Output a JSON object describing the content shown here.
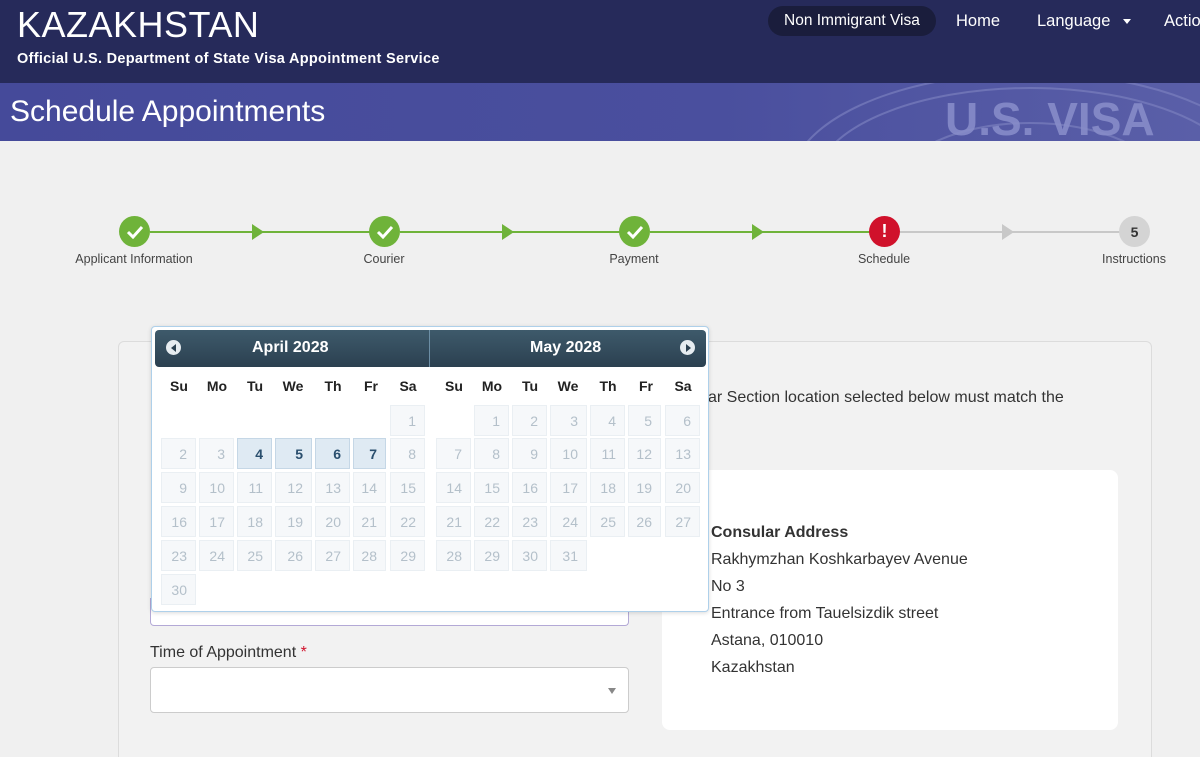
{
  "header": {
    "brand_title": "Kazakhstan",
    "brand_subtitle": "Official U.S. Department of State Visa Appointment Service",
    "visa_type_pill": "Non Immigrant Visa",
    "nav_home": "Home",
    "nav_language": "Language",
    "nav_actions": "Actio"
  },
  "banner": {
    "title": "Schedule Appointments",
    "seal_text": "U.S. VISA"
  },
  "stepper": {
    "steps": [
      {
        "label": "Applicant Information",
        "status": "done"
      },
      {
        "label": "Courier",
        "status": "done"
      },
      {
        "label": "Payment",
        "status": "done"
      },
      {
        "label": "Schedule",
        "status": "error"
      },
      {
        "label": "Instructions",
        "status": "pending",
        "number": "5"
      }
    ]
  },
  "form": {
    "intro_text_partial": "ar Section location selected below must match the",
    "time_label": "Time of Appointment",
    "required_mark": "*",
    "time_value": ""
  },
  "address": {
    "heading": "Consular Address",
    "lines": [
      "Rakhymzhan Koshkarbayev Avenue",
      "No 3",
      "Entrance from Tauelsizdik street",
      "Astana, 010010",
      "Kazakhstan"
    ]
  },
  "datepicker": {
    "weekdays": [
      "Su",
      "Mo",
      "Tu",
      "We",
      "Th",
      "Fr",
      "Sa"
    ],
    "months": [
      {
        "title": "April 2028",
        "days": [
          [
            "",
            "",
            "",
            "",
            "",
            "",
            "1"
          ],
          [
            "2",
            "3",
            "4",
            "5",
            "6",
            "7",
            "8"
          ],
          [
            "9",
            "10",
            "11",
            "12",
            "13",
            "14",
            "15"
          ],
          [
            "16",
            "17",
            "18",
            "19",
            "20",
            "21",
            "22"
          ],
          [
            "23",
            "24",
            "25",
            "26",
            "27",
            "28",
            "29"
          ],
          [
            "30",
            "",
            "",
            "",
            "",
            "",
            ""
          ]
        ],
        "available": [
          "4",
          "5",
          "6",
          "7"
        ]
      },
      {
        "title": "May 2028",
        "days": [
          [
            "",
            "1",
            "2",
            "3",
            "4",
            "5",
            "6"
          ],
          [
            "7",
            "8",
            "9",
            "10",
            "11",
            "12",
            "13"
          ],
          [
            "14",
            "15",
            "16",
            "17",
            "18",
            "19",
            "20"
          ],
          [
            "21",
            "22",
            "23",
            "24",
            "25",
            "26",
            "27"
          ],
          [
            "28",
            "29",
            "30",
            "31",
            "",
            "",
            ""
          ]
        ],
        "available": []
      }
    ]
  },
  "colors": {
    "header_bg": "#262a5a",
    "banner_bg": "#4a4f9e",
    "step_done": "#6fb33a",
    "step_error": "#d0112b",
    "step_pending": "#d4d4d4",
    "datepicker_header": "#2b4050"
  }
}
